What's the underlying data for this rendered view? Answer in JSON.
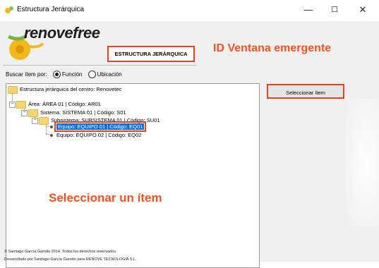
{
  "window": {
    "title": "Estructura Jerárquica",
    "min_glyph": "—",
    "max_glyph": "☐",
    "close_glyph": "✕"
  },
  "logo": {
    "text_a": "renove",
    "text_b": "free"
  },
  "header": {
    "title": "ESTRUCTURA JERÁRQUICA"
  },
  "annotations": {
    "window_id": "ID Ventana emergente",
    "select_item": "Seleccionar un ítem",
    "accent_color": "#f2531e"
  },
  "search": {
    "label": "Buscar ítem por:",
    "options": [
      {
        "label": "Función",
        "checked": true
      },
      {
        "label": "Ubicación",
        "checked": false
      }
    ]
  },
  "tree": {
    "nodes": [
      {
        "label": "Estructura jerárquica del centro: Renovetec"
      },
      {
        "label": "Área: ÁREA 01 | Código: AR01"
      },
      {
        "label": "Sistema: SISTEMA 01 | Código: S01"
      },
      {
        "label": "Subsistema: SUBSISTEMA 01 | Código: SU01"
      },
      {
        "label": "Equipo: EQUIPO 01 | Código: EQ01",
        "selected": true
      },
      {
        "label": "Equipo: EQUIPO 02 | Código: EQ02"
      }
    ]
  },
  "actions": {
    "select_button": "Seleccionar ítem"
  },
  "footer": {
    "line1": "© Santiago García Garrido 2014. Todos los derechos reservados.",
    "line2": "Desarrollado por Santiago García Garrido para RENOVE TECNOLOGIA S.L."
  }
}
